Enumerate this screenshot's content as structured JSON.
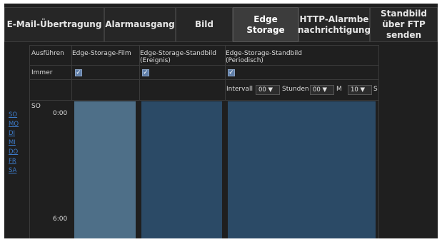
{
  "tabs": [
    {
      "label": "E-Mail-Übertragung",
      "active": false
    },
    {
      "label": "Alarmausgang",
      "active": false
    },
    {
      "label": "Bild",
      "active": false
    },
    {
      "label": "Edge Storage",
      "active": true
    },
    {
      "label": "HTTP-Alarmbe nachrichtigung",
      "active": false
    },
    {
      "label": "Standbild über FTP senden",
      "active": false
    }
  ],
  "schedule": {
    "col_execute": "Ausführen",
    "col_film": "Edge-Storage-Film",
    "col_still_event": "Edge-Storage-Standbild (Ereignis)",
    "col_still_periodic": "Edge-Storage-Standbild (Periodisch)",
    "row_always": "Immer",
    "interval_label": "Intervall",
    "hours_label": "Stunden",
    "minutes_label": "M",
    "seconds_label": "S",
    "hours_value": "00 ▼",
    "minutes_value": "00 ▼",
    "seconds_value": "10 ▼",
    "current_day": "SO",
    "times": [
      "0:00",
      "6:00"
    ],
    "days": [
      "SO",
      "MO",
      "DI",
      "MI",
      "DO",
      "FR",
      "SA"
    ],
    "checked": "✓"
  },
  "colors": {
    "film_bar": "#4e6f88",
    "still_bar": "#2b4a66"
  }
}
